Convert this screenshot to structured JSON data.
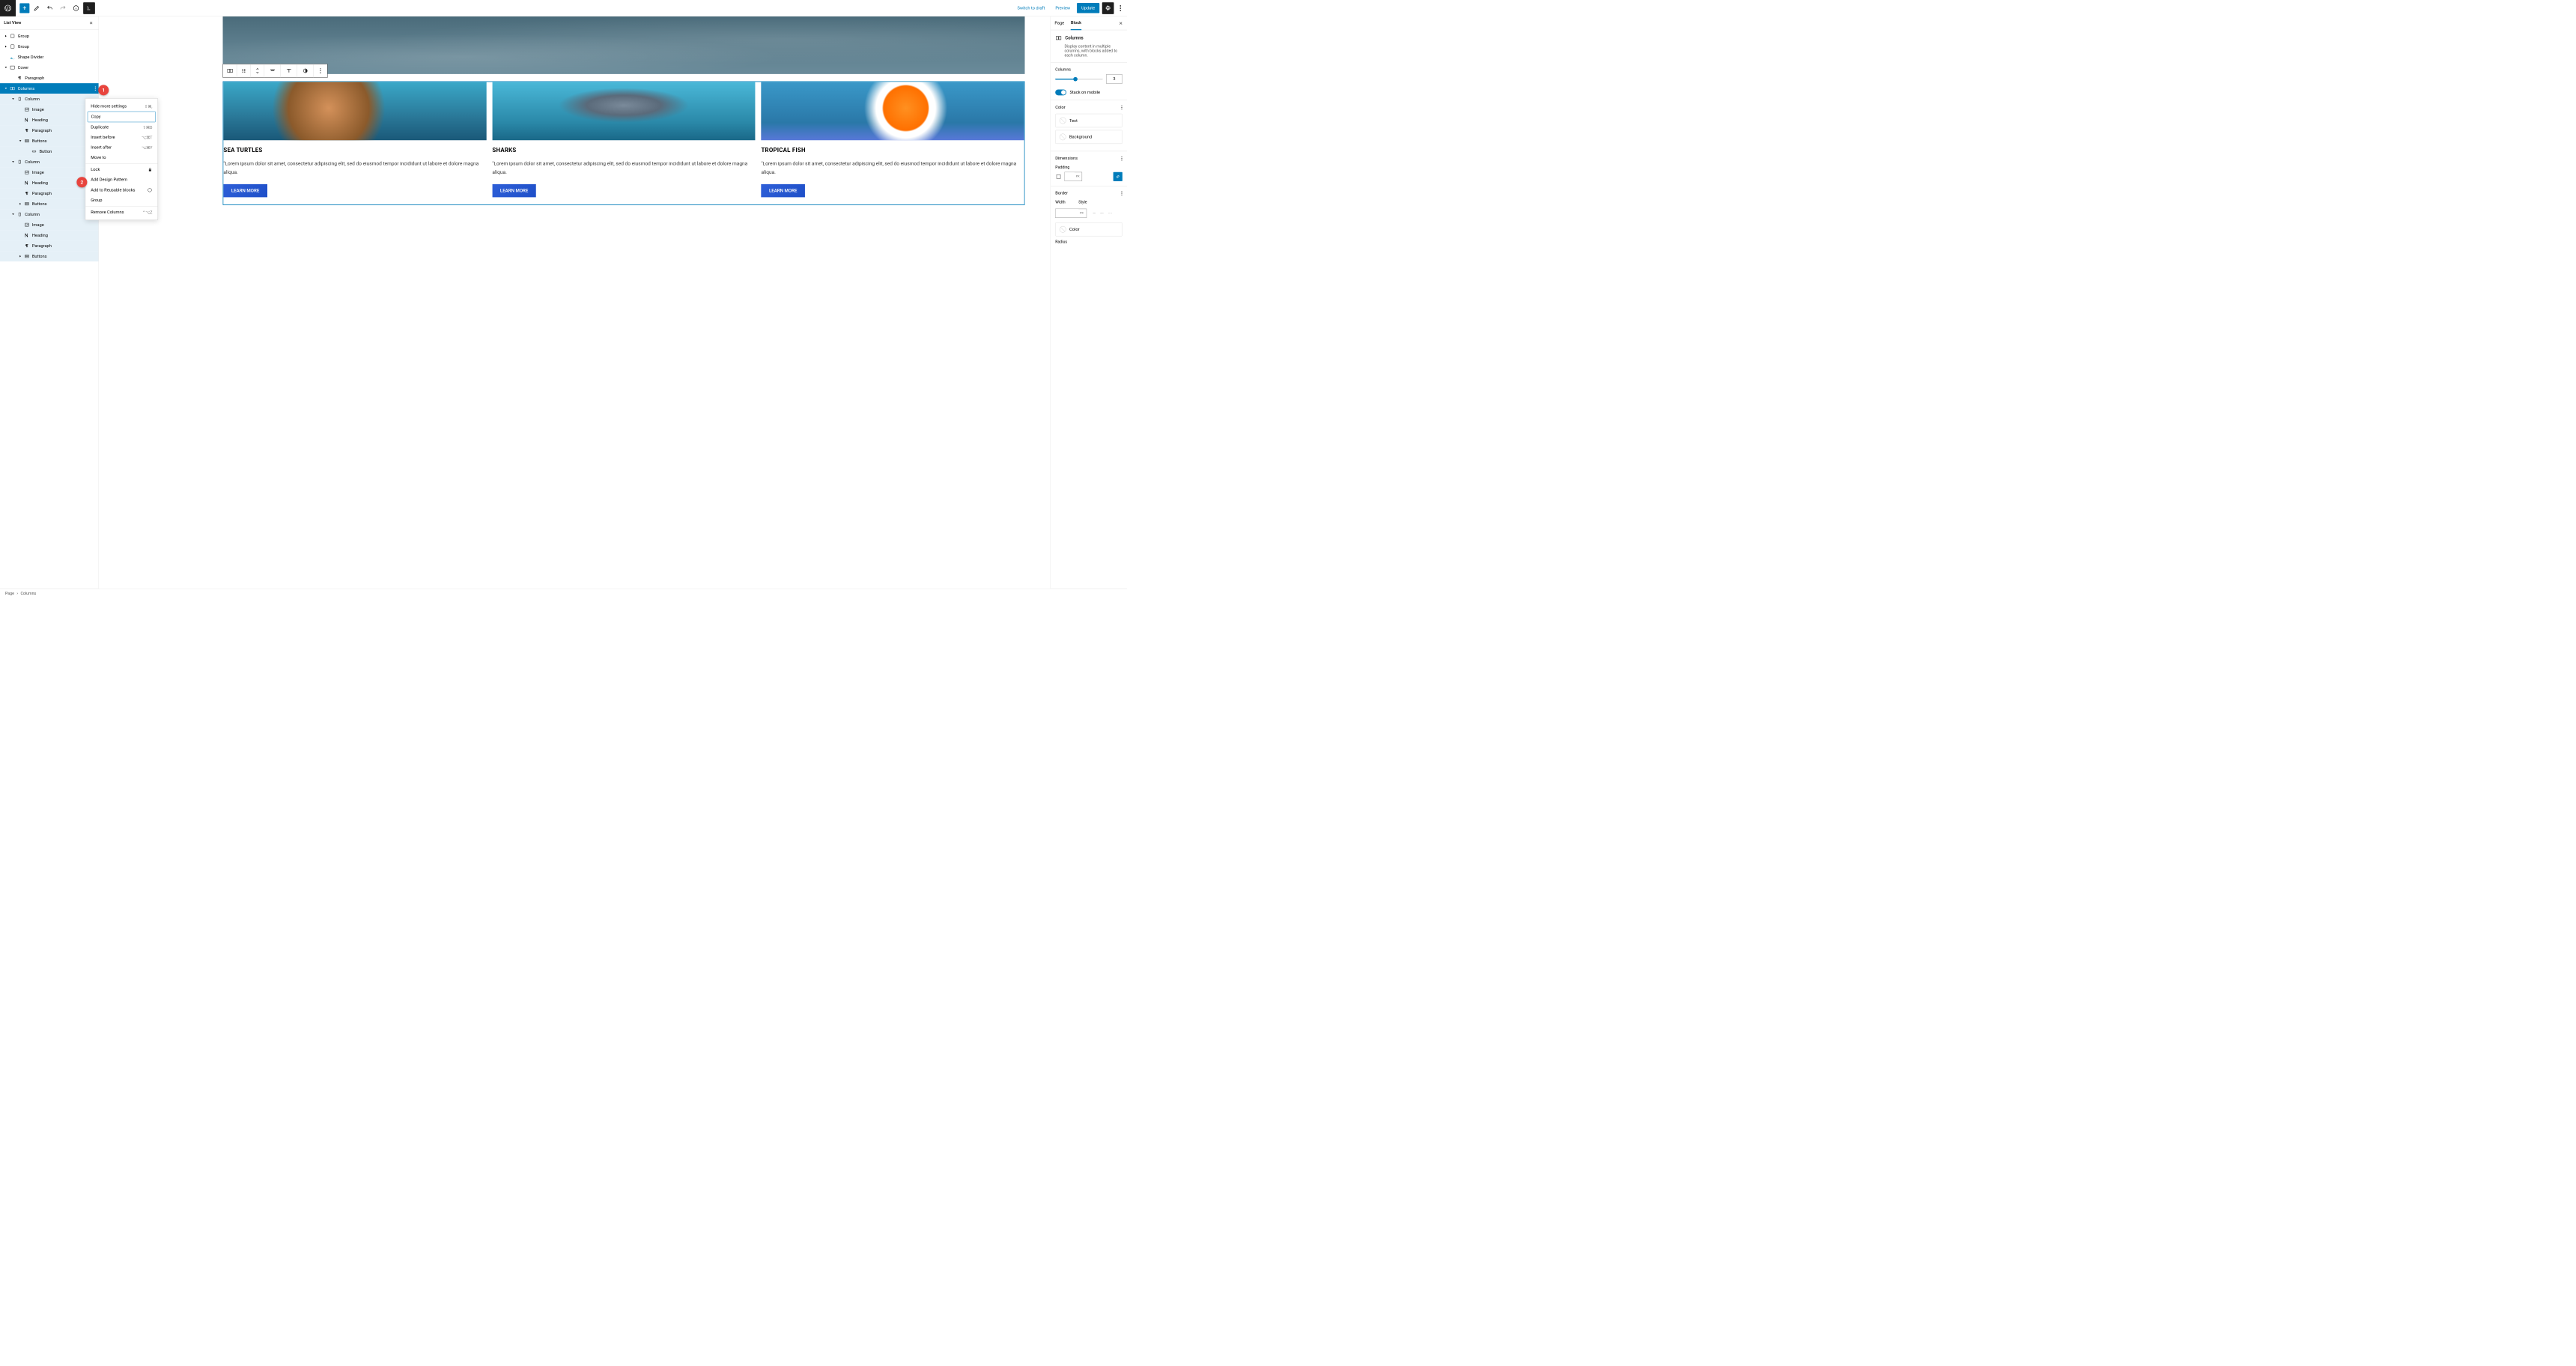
{
  "topbar": {
    "switch_draft": "Switch to draft",
    "preview": "Preview",
    "update": "Update"
  },
  "list_view": {
    "title": "List View",
    "items": [
      {
        "label": "Group",
        "icon": "group",
        "depth": 0,
        "toggle": "closed"
      },
      {
        "label": "Group",
        "icon": "group",
        "depth": 0,
        "toggle": "closed"
      },
      {
        "label": "Shape Divider",
        "icon": "shape",
        "depth": 0,
        "toggle": "none"
      },
      {
        "label": "Cover",
        "icon": "cover",
        "depth": 0,
        "toggle": "open"
      },
      {
        "label": "Paragraph",
        "icon": "para",
        "depth": 1,
        "toggle": "none"
      },
      {
        "label": "Columns",
        "icon": "columns",
        "depth": 0,
        "toggle": "open",
        "selected": true,
        "more": true
      },
      {
        "label": "Column",
        "icon": "column",
        "depth": 1,
        "toggle": "open",
        "childsel": true
      },
      {
        "label": "Image",
        "icon": "image",
        "depth": 2,
        "toggle": "none",
        "childsel": true
      },
      {
        "label": "Heading",
        "icon": "heading",
        "depth": 2,
        "toggle": "none",
        "childsel": true
      },
      {
        "label": "Paragraph",
        "icon": "para",
        "depth": 2,
        "toggle": "none",
        "childsel": true
      },
      {
        "label": "Buttons",
        "icon": "buttons",
        "depth": 2,
        "toggle": "open",
        "childsel": true
      },
      {
        "label": "Button",
        "icon": "button",
        "depth": 3,
        "toggle": "none",
        "childsel": true
      },
      {
        "label": "Column",
        "icon": "column",
        "depth": 1,
        "toggle": "open",
        "childsel": true
      },
      {
        "label": "Image",
        "icon": "image",
        "depth": 2,
        "toggle": "none",
        "childsel": true
      },
      {
        "label": "Heading",
        "icon": "heading",
        "depth": 2,
        "toggle": "none",
        "childsel": true
      },
      {
        "label": "Paragraph",
        "icon": "para",
        "depth": 2,
        "toggle": "none",
        "childsel": true
      },
      {
        "label": "Buttons",
        "icon": "buttons",
        "depth": 2,
        "toggle": "closed",
        "childsel": true
      },
      {
        "label": "Column",
        "icon": "column",
        "depth": 1,
        "toggle": "open",
        "childsel": true
      },
      {
        "label": "Image",
        "icon": "image",
        "depth": 2,
        "toggle": "none",
        "childsel": true
      },
      {
        "label": "Heading",
        "icon": "heading",
        "depth": 2,
        "toggle": "none",
        "childsel": true
      },
      {
        "label": "Paragraph",
        "icon": "para",
        "depth": 2,
        "toggle": "none",
        "childsel": true
      },
      {
        "label": "Buttons",
        "icon": "buttons",
        "depth": 2,
        "toggle": "closed",
        "childsel": true
      }
    ]
  },
  "context_menu": {
    "items": [
      {
        "label": "Hide more settings",
        "shortcut": "⇧⌘,"
      },
      {
        "label": "Copy",
        "highlight": true
      },
      {
        "label": "Duplicate",
        "shortcut": "⇧⌘D"
      },
      {
        "label": "Insert before",
        "shortcut": "⌥⌘T"
      },
      {
        "label": "Insert after",
        "shortcut": "⌥⌘Y"
      },
      {
        "label": "Move to"
      },
      {
        "label": "Lock",
        "icon": "lock",
        "sep_before": true
      },
      {
        "label": "Add Design Pattern"
      },
      {
        "label": "Add to Reusable blocks",
        "icon": "reusable"
      },
      {
        "label": "Group"
      },
      {
        "label": "Remove Columns",
        "shortcut": "⌃⌥Z",
        "sep_before": true
      }
    ]
  },
  "canvas": {
    "columns": [
      {
        "heading": "SEA TURTLES",
        "para": "\"Lorem ipsum dolor sit amet, consectetur adipiscing elit, sed do eiusmod tempor incididunt ut labore et dolore magna aliqua.",
        "btn": "LEARN MORE"
      },
      {
        "heading": "SHARKS",
        "para": "\"Lorem ipsum dolor sit amet, consectetur adipiscing elit, sed do eiusmod tempor incididunt ut labore et dolore magna aliqua.",
        "btn": "LEARN MORE"
      },
      {
        "heading": "TROPICAL FISH",
        "para": "\"Lorem ipsum dolor sit amet, consectetur adipiscing elit, sed do eiusmod tempor incididunt ut labore et dolore magna aliqua.",
        "btn": "LEARN MORE"
      }
    ]
  },
  "sidebar": {
    "tabs": {
      "page": "Page",
      "block": "Block"
    },
    "block_name": "Columns",
    "block_desc": "Display content in multiple columns, with blocks added to each column.",
    "columns_label": "Columns",
    "columns_value": "3",
    "stack_label": "Stack on mobile",
    "color_label": "Color",
    "text_label": "Text",
    "bg_label": "Background",
    "dimensions_label": "Dimensions",
    "padding_label": "Padding",
    "padding_unit": "PX",
    "border_label": "Border",
    "width_label": "Width",
    "width_unit": "PX",
    "style_label": "Style",
    "border_color_label": "Color",
    "radius_label": "Radius"
  },
  "breadcrumb": {
    "root": "Page",
    "current": "Columns"
  },
  "callouts": {
    "1": "1",
    "2": "2"
  }
}
